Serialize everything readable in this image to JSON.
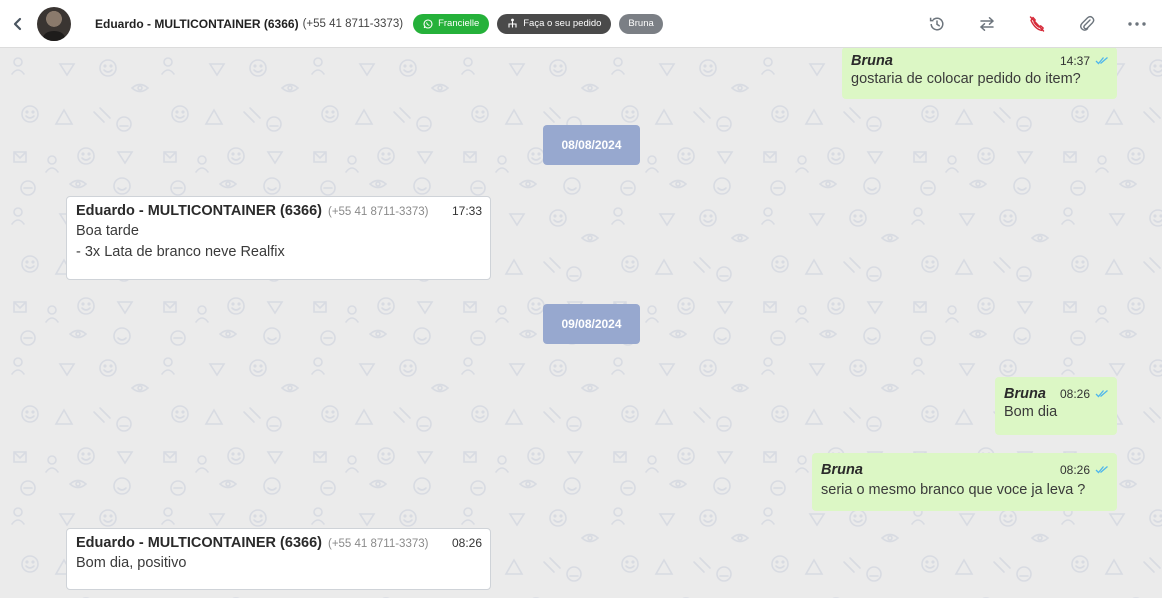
{
  "header": {
    "contact_name": "Eduardo - MULTICONTAINER (6366)",
    "contact_phone": "(+55 41 8711-3373)",
    "tags": [
      {
        "label": "Francielle",
        "color": "#25b13a",
        "icon": "whatsapp-icon"
      },
      {
        "label": "Faça o seu pedido",
        "color": "#4a4a4a",
        "icon": "flow-icon"
      },
      {
        "label": "Bruna",
        "color": "#7b7f85",
        "icon": ""
      }
    ],
    "actions": [
      "history-icon",
      "transfer-icon",
      "end-call-icon",
      "attach-icon",
      "more-icon"
    ]
  },
  "chat": {
    "messages": [
      {
        "direction": "out",
        "sender": "Bruna",
        "time": "14:37",
        "text": "gostaria de colocar pedido do item?"
      },
      {
        "type": "date",
        "label": "08/08/2024"
      },
      {
        "direction": "in",
        "sender": "Eduardo - MULTICONTAINER (6366)",
        "phone": "(+55 41 8711-3373)",
        "time": "17:33",
        "lines": [
          "Boa tarde",
          "- 3x Lata de branco neve Realfix"
        ]
      },
      {
        "type": "date",
        "label": "09/08/2024"
      },
      {
        "direction": "out",
        "sender": "Bruna",
        "time": "08:26",
        "text": "Bom dia"
      },
      {
        "direction": "out",
        "sender": "Bruna",
        "time": "08:26",
        "text": "seria o mesmo branco que voce ja leva ?"
      },
      {
        "direction": "in",
        "sender": "Eduardo - MULTICONTAINER (6366)",
        "phone": "(+55 41 8711-3373)",
        "time": "08:26",
        "lines": [
          "Bom dia, positivo"
        ]
      }
    ]
  },
  "colors": {
    "incoming_bg": "#ffffff",
    "outgoing_bg": "#dcf7c5",
    "date_pill": "#97a8cf",
    "read_ticks": "#4fb6ec",
    "end_call": "#d62b3a"
  }
}
